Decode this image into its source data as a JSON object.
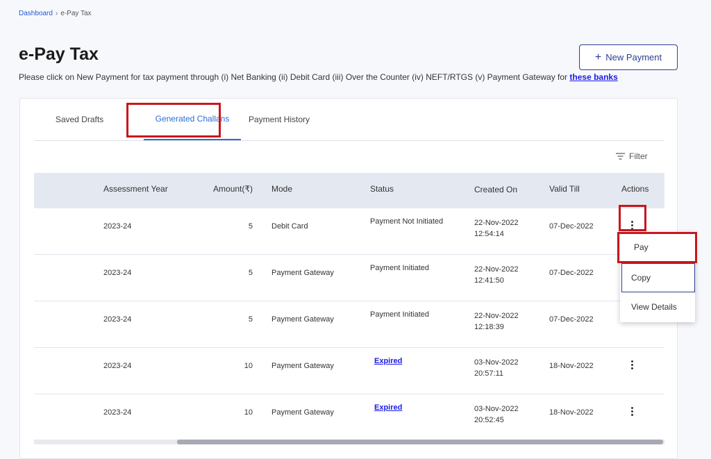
{
  "breadcrumb": {
    "home": "Dashboard",
    "separator": "›",
    "current": "e-Pay Tax"
  },
  "page": {
    "title": "e-Pay Tax",
    "subtitle_text": "Please click on New Payment for tax payment through (i) Net Banking (ii) Debit Card (iii) Over the Counter (iv) NEFT/RTGS (v) Payment Gateway for",
    "subtitle_link": "these banks",
    "new_payment_label": "New Payment",
    "new_payment_icon": "+"
  },
  "tabs": [
    {
      "label": "Saved Drafts"
    },
    {
      "label": "Generated Challans"
    },
    {
      "label": "Payment History"
    }
  ],
  "filter_label": "Filter",
  "table": {
    "headers": {
      "year": "Assessment Year",
      "amount": "Amount(₹)",
      "mode": "Mode",
      "status": "Status",
      "created": "Created On",
      "valid": "Valid Till",
      "actions": "Actions"
    },
    "rows": [
      {
        "year": "2023-24",
        "amount": "5",
        "mode": "Debit Card",
        "status": "Payment Not Initiated",
        "created_date": "22-Nov-2022",
        "created_time": "12:54:14",
        "valid": "07-Dec-2022"
      },
      {
        "year": "2023-24",
        "amount": "5",
        "mode": "Payment Gateway",
        "status": "Payment Initiated",
        "created_date": "22-Nov-2022",
        "created_time": "12:41:50",
        "valid": "07-Dec-2022"
      },
      {
        "year": "2023-24",
        "amount": "5",
        "mode": "Payment Gateway",
        "status": "Payment Initiated",
        "created_date": "22-Nov-2022",
        "created_time": "12:18:39",
        "valid": "07-Dec-2022"
      },
      {
        "year": "2023-24",
        "amount": "10",
        "mode": "Payment Gateway",
        "status": "Expired",
        "created_date": "03-Nov-2022",
        "created_time": "20:57:11",
        "valid": "18-Nov-2022"
      },
      {
        "year": "2023-24",
        "amount": "10",
        "mode": "Payment Gateway",
        "status": "Expired",
        "created_date": "03-Nov-2022",
        "created_time": "20:52:45",
        "valid": "18-Nov-2022"
      }
    ]
  },
  "action_menu": {
    "pay": "Pay",
    "copy": "Copy",
    "view": "View Details"
  },
  "colors": {
    "accent": "#2a6dd6",
    "highlight": "#c8161e",
    "link": "#1a1ae6",
    "header_bg": "#e4e8f1"
  }
}
